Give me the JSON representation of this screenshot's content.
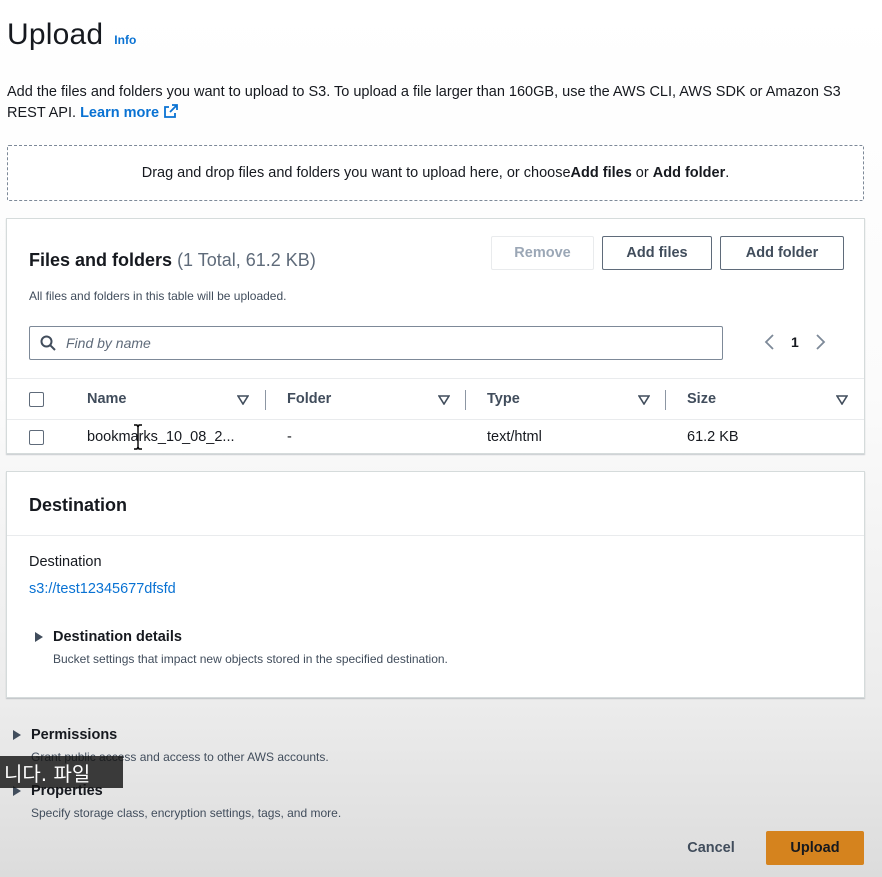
{
  "header": {
    "title": "Upload",
    "info_label": "Info"
  },
  "description": {
    "text": "Add the files and folders you want to upload to S3. To upload a file larger than 160GB, use the AWS CLI, AWS SDK or Amazon S3 REST API.",
    "learn_more": "Learn more"
  },
  "dropzone": {
    "prefix": "Drag and drop files and folders you want to upload here, or choose ",
    "add_files": "Add files",
    "or": " or ",
    "add_folder": "Add folder",
    "suffix": "."
  },
  "files_panel": {
    "title": "Files and folders",
    "count": "(1 Total, 61.2 KB)",
    "subtitle": "All files and folders in this table will be uploaded.",
    "remove_label": "Remove",
    "add_files_label": "Add files",
    "add_folder_label": "Add folder",
    "search_placeholder": "Find by name",
    "page": "1",
    "columns": [
      "Name",
      "Folder",
      "Type",
      "Size"
    ],
    "rows": [
      {
        "name": "bookmarks_10_08_2...",
        "folder": "-",
        "type": "text/html",
        "size": "61.2 KB"
      }
    ]
  },
  "destination": {
    "title": "Destination",
    "label": "Destination",
    "link": "s3://test12345677dfsfd",
    "details_label": "Destination details",
    "details_desc": "Bucket settings that impact new objects stored in the specified destination."
  },
  "permissions": {
    "label": "Permissions",
    "desc": "Grant public access and access to other AWS accounts."
  },
  "properties": {
    "label": "Properties",
    "desc": "Specify storage class, encryption settings, tags, and more."
  },
  "footer": {
    "cancel_label": "Cancel",
    "upload_label": "Upload"
  },
  "overlay": {
    "subtitle": "니다. 파일"
  },
  "colors": {
    "link": "#0972d3",
    "primary_button": "#d5831e",
    "text": "#16191f"
  }
}
